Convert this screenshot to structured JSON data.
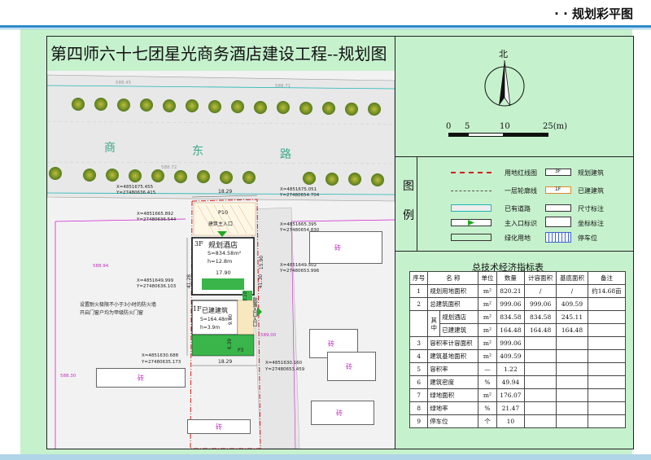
{
  "header": {
    "title": "· · 规划彩平图"
  },
  "plan": {
    "title": "第四师六十七团星光商务酒店建设工程--规划图"
  },
  "compass": {
    "north": "北"
  },
  "scale": {
    "labels": [
      "0",
      "5",
      "10",
      "25(m)"
    ]
  },
  "legend": {
    "heading": "图 例",
    "items": [
      {
        "label": "用地红线图"
      },
      {
        "label": "规划建筑",
        "mark": "3F"
      },
      {
        "label": "一层轮廓线"
      },
      {
        "label": "已建建筑",
        "mark": "1F"
      },
      {
        "label": "已有道路"
      },
      {
        "label": "尺寸标注"
      },
      {
        "label": "主入口标识"
      },
      {
        "label": "坐标标注"
      },
      {
        "label": "绿化用地"
      },
      {
        "label": "停车位"
      }
    ]
  },
  "indicators": {
    "title": "总技术经济指标表",
    "headers": [
      "序号",
      "名 称",
      "单位",
      "数量",
      "计容面积",
      "基底面积",
      "备注"
    ],
    "rows": [
      {
        "no": "1",
        "name": "规划用地面积",
        "unit": "m²",
        "qty": "820.21",
        "far": "/",
        "base": "/",
        "note": "约14.68亩"
      },
      {
        "no": "2",
        "name": "总建筑面积",
        "unit": "m²",
        "qty": "999.06",
        "far": "999.06",
        "base": "409.59",
        "note": ""
      },
      {
        "no": "",
        "name": "规划酒店",
        "unit": "m²",
        "qty": "834.58",
        "far": "834.58",
        "base": "245.11",
        "note": ""
      },
      {
        "no": "",
        "name": "已建建筑",
        "unit": "m²",
        "qty": "164.48",
        "far": "164.48",
        "base": "164.48",
        "note": ""
      },
      {
        "no": "3",
        "name": "容积率计容面积",
        "unit": "m²",
        "qty": "999.06",
        "far": "",
        "base": "",
        "note": ""
      },
      {
        "no": "4",
        "name": "建筑基地面积",
        "unit": "m²",
        "qty": "409.59",
        "far": "",
        "base": "",
        "note": ""
      },
      {
        "no": "5",
        "name": "容积率",
        "unit": "—",
        "qty": "1.22",
        "far": "",
        "base": "",
        "note": ""
      },
      {
        "no": "6",
        "name": "建筑密度",
        "unit": "%",
        "qty": "49.94",
        "far": "",
        "base": "",
        "note": ""
      },
      {
        "no": "7",
        "name": "绿地面积",
        "unit": "m²",
        "qty": "176.07",
        "far": "",
        "base": "",
        "note": ""
      },
      {
        "no": "8",
        "name": "绿地率",
        "unit": "%",
        "qty": "21.47",
        "far": "",
        "base": "",
        "note": ""
      },
      {
        "no": "9",
        "name": "停车位",
        "unit": "个",
        "qty": "10",
        "far": "",
        "base": "",
        "note": ""
      }
    ],
    "sub_label": "其中"
  },
  "map_labels": {
    "road": [
      "商",
      "东",
      "路"
    ],
    "coord_top_left": [
      "X=4851675.455",
      "Y=27480636.415"
    ],
    "coord_top_right": [
      "X=4851675.051",
      "Y=27480654.704"
    ],
    "dim_top": "18.29",
    "coord_mid_left": [
      "X=4851665.892",
      "Y=27480636.544"
    ],
    "coord_mid_right": [
      "X=4851665.395",
      "Y=27480654.830"
    ],
    "parking": "P10",
    "main_entrance": "建筑主入口",
    "hotel": {
      "floors": "3F",
      "name": "规划酒店",
      "area": "S=834.58m²",
      "height": "h=12.8m"
    },
    "dim_hotel_w": "17.90",
    "dim_hotel_h": "15.90",
    "coord_left2": [
      "X=4851649.999",
      "Y=27480636.103"
    ],
    "coord_right2": [
      "X=4851649.502",
      "Y=27480653.996"
    ],
    "dim_side": "41.28",
    "dim_side2": "41.30",
    "dim_small": "3.10",
    "side_entrance": "院落入口入口",
    "fire_note": [
      "设置耐火极限不小于3小时的防火墙",
      "开启门窗户均为甲级防火门窗"
    ],
    "existing": {
      "floors": "1F",
      "name": "已建建筑",
      "area": "S=164.48m²",
      "height": "h=3.9m"
    },
    "dim_exist": "9.00",
    "dim_exist2": "6.39",
    "p3": "P3",
    "coord_bottom_left": [
      "X=4851630.688",
      "Y=27480635.173"
    ],
    "coord_bottom_right": [
      "X=4851630.160",
      "Y=27480653.459"
    ],
    "dim_bottom": "18.29",
    "building_mark": "砖",
    "level_marks": [
      "588.45",
      "588.71",
      "588.72",
      "588.94",
      "589.00",
      "588.30"
    ]
  }
}
